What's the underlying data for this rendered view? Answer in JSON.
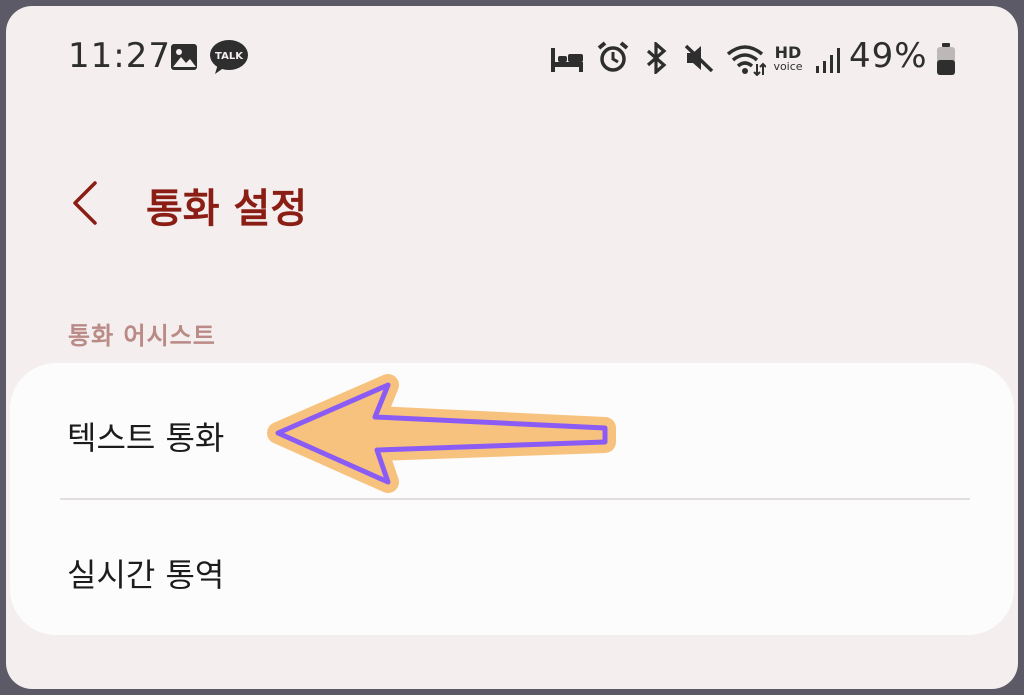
{
  "status_bar": {
    "time": "11:27",
    "battery": "49%",
    "kakao_badge": "TALK",
    "hd_label": "HD",
    "voice_label": "voice"
  },
  "header": {
    "title": "통화 설정"
  },
  "section": {
    "title": "통화 어시스트",
    "items": [
      {
        "label": "텍스트 통화"
      },
      {
        "label": "실시간 통역"
      }
    ]
  },
  "colors": {
    "title": "#8a1d14",
    "section_title": "#b98a86",
    "background": "#f4eeee",
    "arrow_fill": "#f7c27e",
    "arrow_stroke": "#8a5cf5"
  }
}
